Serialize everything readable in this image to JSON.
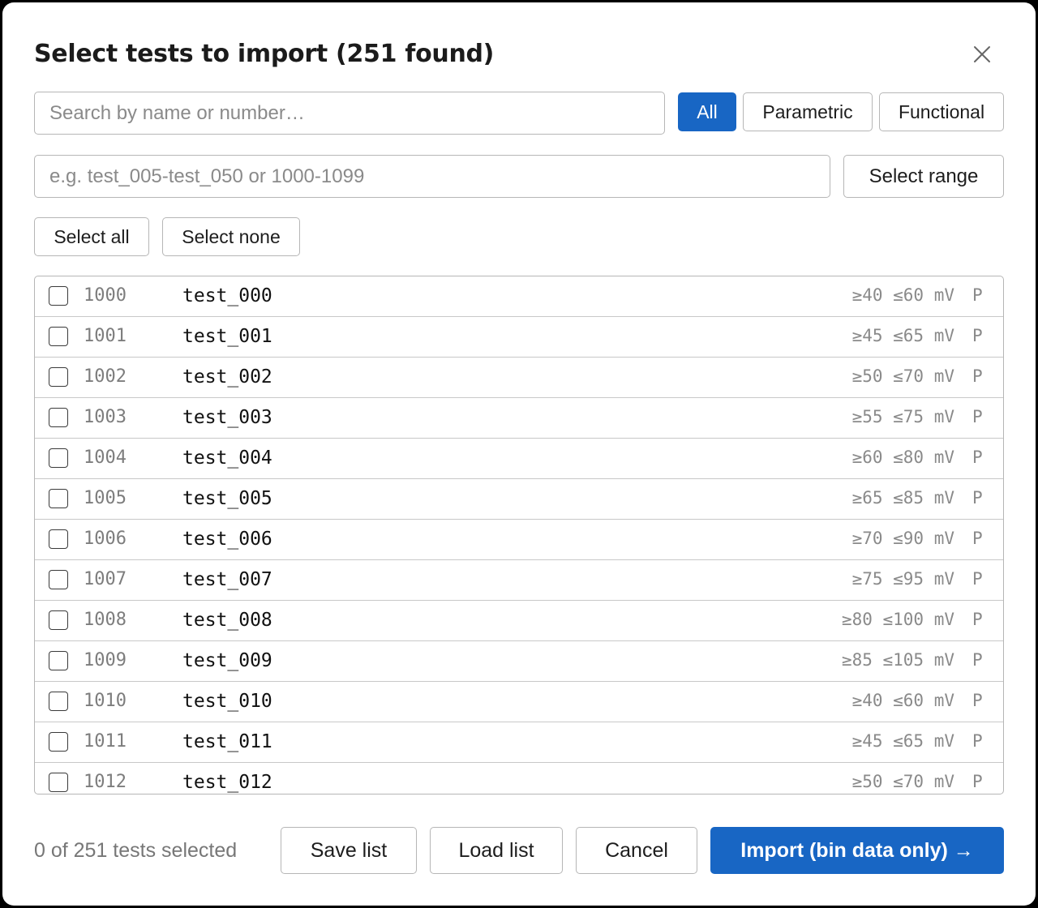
{
  "dialog": {
    "title": "Select tests to import (251 found)",
    "close_icon": "close-icon"
  },
  "search": {
    "placeholder": "Search by name or number…",
    "value": ""
  },
  "filters": {
    "all": "All",
    "parametric": "Parametric",
    "functional": "Functional",
    "active": "All"
  },
  "range": {
    "placeholder": "e.g. test_005-test_050 or 1000-1099",
    "value": "",
    "button": "Select range"
  },
  "selection": {
    "all": "Select all",
    "none": "Select none"
  },
  "tests": [
    {
      "number": "1000",
      "name": "test_000",
      "limits": "≥40 ≤60 mV",
      "type": "P",
      "checked": false
    },
    {
      "number": "1001",
      "name": "test_001",
      "limits": "≥45 ≤65 mV",
      "type": "P",
      "checked": false
    },
    {
      "number": "1002",
      "name": "test_002",
      "limits": "≥50 ≤70 mV",
      "type": "P",
      "checked": false
    },
    {
      "number": "1003",
      "name": "test_003",
      "limits": "≥55 ≤75 mV",
      "type": "P",
      "checked": false
    },
    {
      "number": "1004",
      "name": "test_004",
      "limits": "≥60 ≤80 mV",
      "type": "P",
      "checked": false
    },
    {
      "number": "1005",
      "name": "test_005",
      "limits": "≥65 ≤85 mV",
      "type": "P",
      "checked": false
    },
    {
      "number": "1006",
      "name": "test_006",
      "limits": "≥70 ≤90 mV",
      "type": "P",
      "checked": false
    },
    {
      "number": "1007",
      "name": "test_007",
      "limits": "≥75 ≤95 mV",
      "type": "P",
      "checked": false
    },
    {
      "number": "1008",
      "name": "test_008",
      "limits": "≥80 ≤100 mV",
      "type": "P",
      "checked": false
    },
    {
      "number": "1009",
      "name": "test_009",
      "limits": "≥85 ≤105 mV",
      "type": "P",
      "checked": false
    },
    {
      "number": "1010",
      "name": "test_010",
      "limits": "≥40 ≤60 mV",
      "type": "P",
      "checked": false
    },
    {
      "number": "1011",
      "name": "test_011",
      "limits": "≥45 ≤65 mV",
      "type": "P",
      "checked": false
    },
    {
      "number": "1012",
      "name": "test_012",
      "limits": "≥50 ≤70 mV",
      "type": "P",
      "checked": false
    }
  ],
  "footer": {
    "status": "0 of 251 tests selected",
    "save_list": "Save list",
    "load_list": "Load list",
    "cancel": "Cancel",
    "import": "Import (bin data only) →"
  },
  "colors": {
    "primary": "#1866c4",
    "border": "#b6b6b6",
    "muted_text": "#8a8a8a"
  }
}
